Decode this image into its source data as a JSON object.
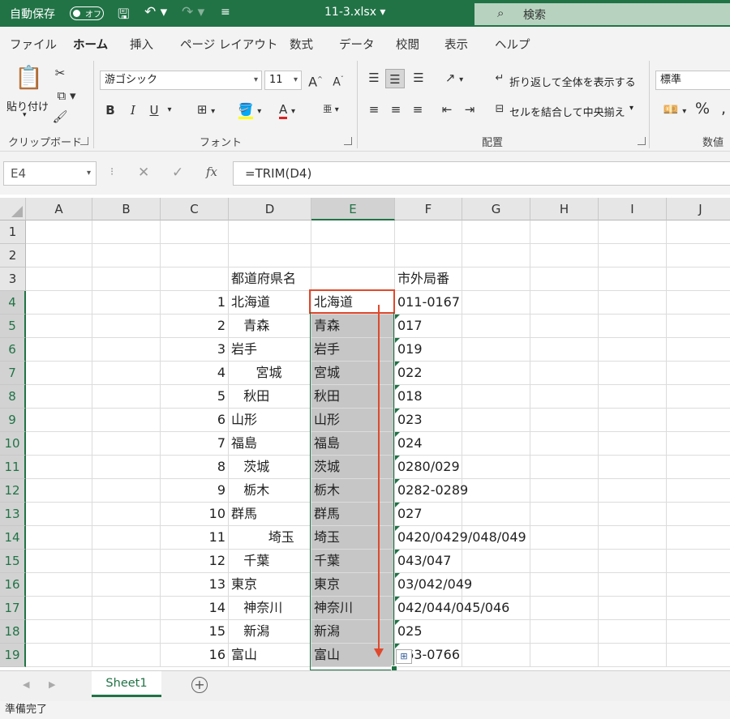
{
  "titlebar": {
    "autosave_label": "自動保存",
    "autosave_state": "オフ",
    "filename": "11-3.xlsx",
    "search_placeholder": "検索"
  },
  "ribbon_tabs": [
    "ファイル",
    "ホーム",
    "挿入",
    "ページ レイアウト",
    "数式",
    "データ",
    "校閲",
    "表示",
    "ヘルプ"
  ],
  "ribbon": {
    "clipboard": {
      "paste": "貼り付け",
      "group": "クリップボード"
    },
    "font": {
      "name": "游ゴシック",
      "size": "11",
      "group": "フォント",
      "bold": "B",
      "italic": "I",
      "underline": "U",
      "grow": "A",
      "shrink": "A"
    },
    "alignment": {
      "wrap": "折り返して全体を表示する",
      "merge": "セルを結合して中央揃え",
      "group": "配置"
    },
    "number": {
      "format": "標準",
      "group": "数値"
    }
  },
  "formula_bar": {
    "name_box": "E4",
    "fx": "fx",
    "formula": "=TRIM(D4)"
  },
  "columns": [
    "A",
    "B",
    "C",
    "D",
    "E",
    "F",
    "G",
    "H",
    "I",
    "J"
  ],
  "rows": [
    {
      "n": "1",
      "C": "",
      "D": "",
      "E": "",
      "F": ""
    },
    {
      "n": "2",
      "C": "",
      "D": "",
      "E": "",
      "F": ""
    },
    {
      "n": "3",
      "C": "",
      "D": "都道府県名",
      "E": "",
      "F": "市外局番"
    },
    {
      "n": "4",
      "C": "1",
      "D": "北海道",
      "E": "北海道",
      "F": "011-0167"
    },
    {
      "n": "5",
      "C": "2",
      "D": "   青森",
      "E": "青森",
      "F": "017"
    },
    {
      "n": "6",
      "C": "3",
      "D": "岩手",
      "E": "岩手",
      "F": "019"
    },
    {
      "n": "7",
      "C": "4",
      "D": "      宮城",
      "E": "宮城",
      "F": "022"
    },
    {
      "n": "8",
      "C": "5",
      "D": "   秋田",
      "E": "秋田",
      "F": "018"
    },
    {
      "n": "9",
      "C": "6",
      "D": "山形",
      "E": "山形",
      "F": "023"
    },
    {
      "n": "10",
      "C": "7",
      "D": "福島",
      "E": "福島",
      "F": "024"
    },
    {
      "n": "11",
      "C": "8",
      "D": "   茨城",
      "E": "茨城",
      "F": "0280/029"
    },
    {
      "n": "12",
      "C": "9",
      "D": "   栃木",
      "E": "栃木",
      "F": "0282-0289"
    },
    {
      "n": "13",
      "C": "10",
      "D": "群馬",
      "E": "群馬",
      "F": "027"
    },
    {
      "n": "14",
      "C": "11",
      "D": "         埼玉",
      "E": "埼玉",
      "F": "0420/0429/048/049"
    },
    {
      "n": "15",
      "C": "12",
      "D": "   千葉",
      "E": "千葉",
      "F": "043/047"
    },
    {
      "n": "16",
      "C": "13",
      "D": "東京",
      "E": "東京",
      "F": "03/042/049"
    },
    {
      "n": "17",
      "C": "14",
      "D": "   神奈川",
      "E": "神奈川",
      "F": "042/044/045/046"
    },
    {
      "n": "18",
      "C": "15",
      "D": "   新潟",
      "E": "新潟",
      "F": "025"
    },
    {
      "n": "19",
      "C": "16",
      "D": "富山",
      "E": "富山",
      "F": "  63-0766"
    }
  ],
  "sheet_tab": "Sheet1",
  "status": "準備完了",
  "colors": {
    "excel_green": "#217346",
    "selection_fill": "#c6c6c6",
    "active_border": "#e0492c",
    "fill_arrow": "#e0492c"
  }
}
